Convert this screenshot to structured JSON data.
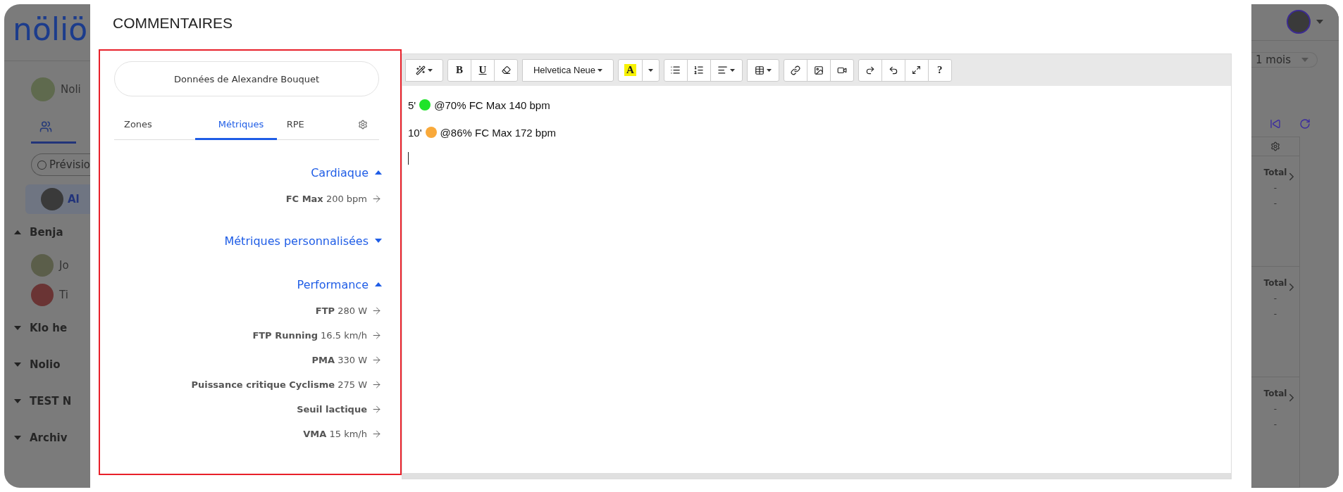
{
  "background": {
    "logo": "nöliö",
    "left": {
      "account": "Noli",
      "filter": "Prévisio",
      "athlete": "Al",
      "groups": [
        {
          "label": "Benja",
          "expanded": true,
          "members": [
            "Jo",
            "Ti"
          ]
        },
        {
          "label": "Klo he",
          "expanded": false
        },
        {
          "label": "Nolio",
          "expanded": false
        },
        {
          "label": "TEST N",
          "expanded": false
        },
        {
          "label": "Archiv",
          "expanded": false
        }
      ]
    },
    "right": {
      "period": "1 mois",
      "totals": [
        {
          "label": "Total",
          "values": [
            "-",
            "-"
          ]
        },
        {
          "label": "Total",
          "values": [
            "-",
            "-"
          ]
        },
        {
          "label": "Total",
          "values": [
            "-",
            "-"
          ]
        }
      ]
    }
  },
  "modal": {
    "title": "COMMENTAIRES",
    "athlete_button": "Données de Alexandre Bouquet",
    "tabs": [
      {
        "label": "Zones",
        "selected": false
      },
      {
        "label": "Métriques",
        "selected": true
      },
      {
        "label": "RPE",
        "selected": false
      }
    ],
    "sections": [
      {
        "title": "Cardiaque",
        "expanded": true,
        "metrics": [
          {
            "name": "FC Max",
            "value": "200 bpm"
          }
        ]
      },
      {
        "title": "Métriques personnalisées",
        "expanded": false
      },
      {
        "title": "Performance",
        "expanded": true,
        "metrics": [
          {
            "name": "FTP",
            "value": "280 W"
          },
          {
            "name": "FTP Running",
            "value": "16.5 km/h"
          },
          {
            "name": "PMA",
            "value": "330 W"
          },
          {
            "name": "Puissance critique Cyclisme",
            "value": "275 W"
          },
          {
            "name": "Seuil lactique"
          },
          {
            "name": "VMA",
            "value": "15 km/h"
          }
        ]
      }
    ],
    "toolbar": {
      "bold": "B",
      "underline": "U",
      "font": "Helvetica Neue",
      "text_color_button": "A",
      "help": "?"
    },
    "lines": [
      {
        "duration": "5'",
        "color": "#1fe32a",
        "text": "@70% FC Max 140 bpm"
      },
      {
        "duration": "10'",
        "color": "#f9a93a",
        "text": "@86% FC Max 172 bpm"
      }
    ]
  }
}
